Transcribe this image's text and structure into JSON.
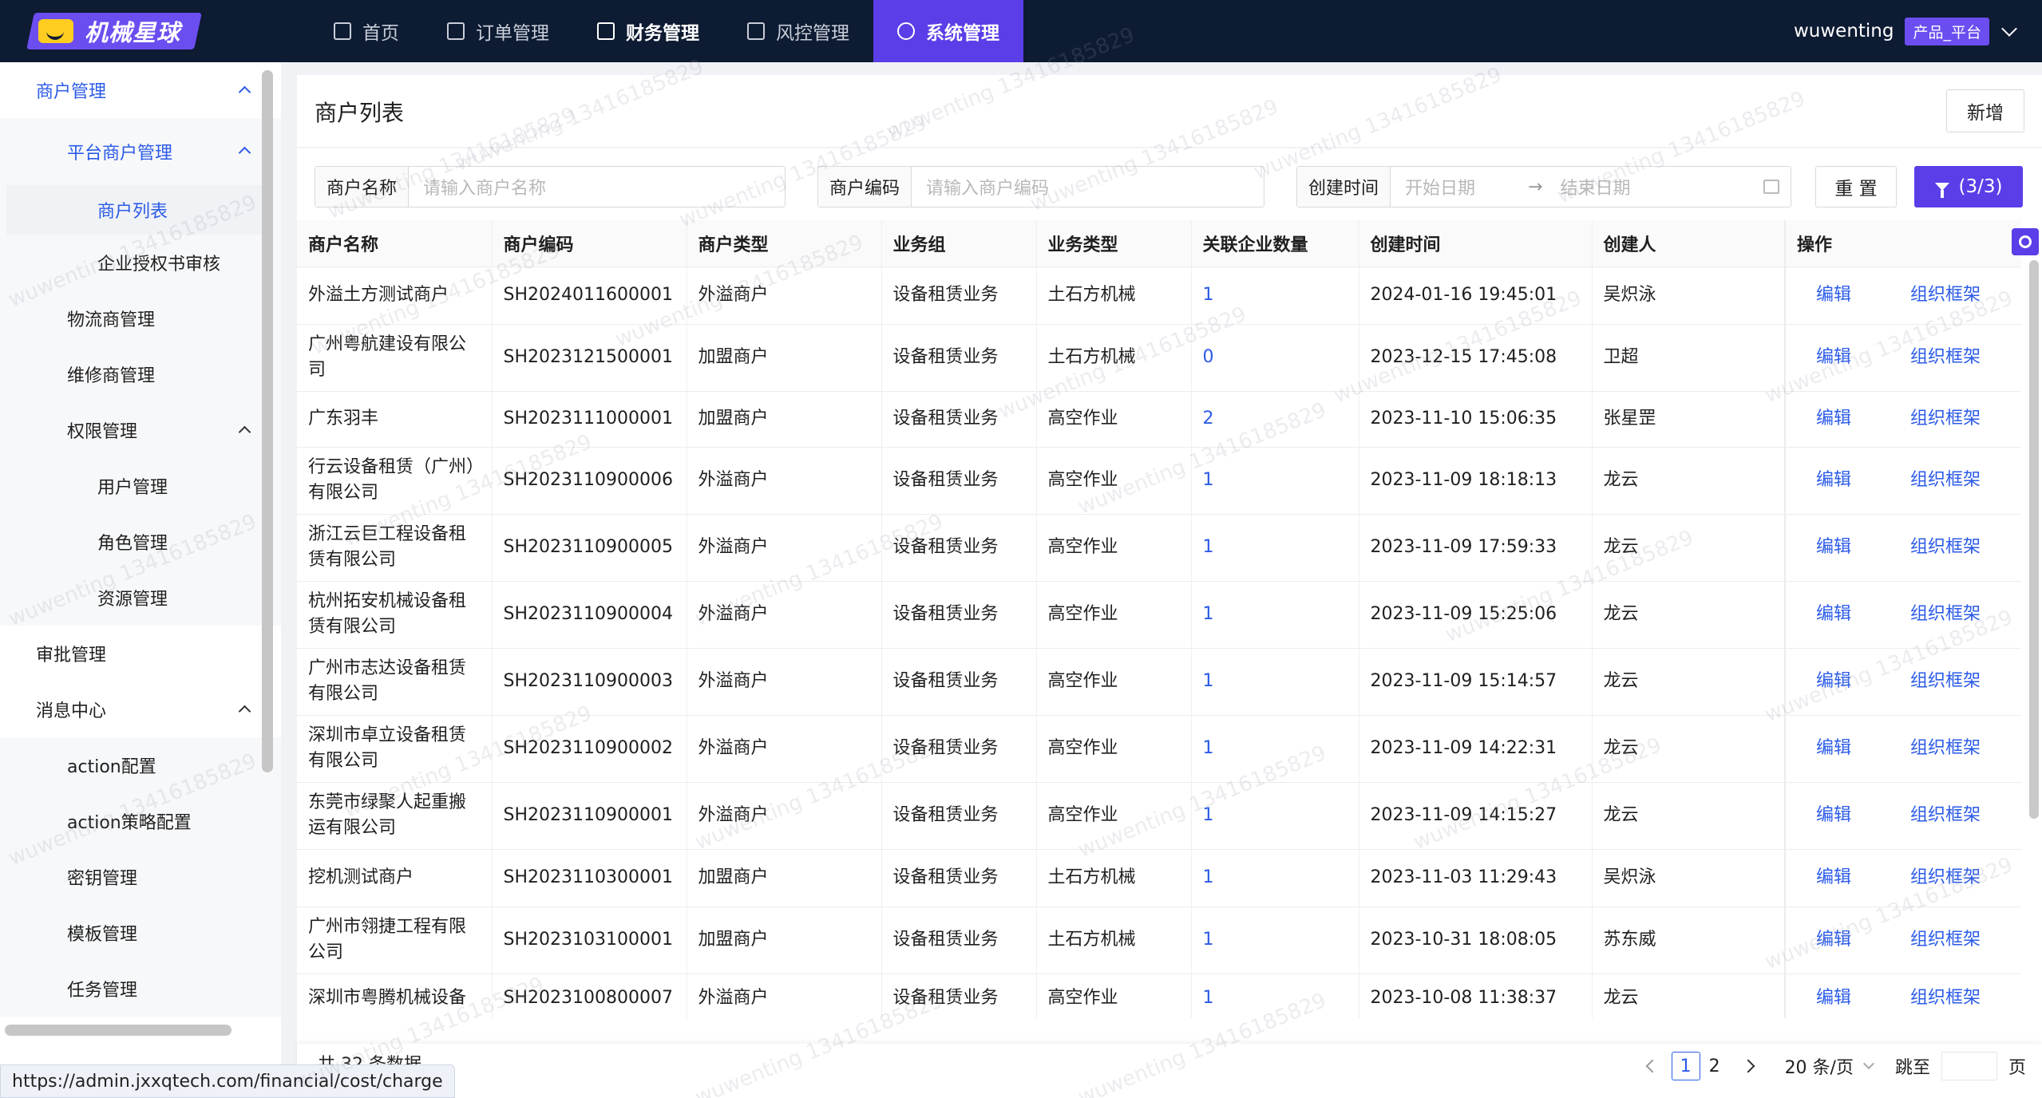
{
  "app": {
    "logo_text": "机械星球"
  },
  "nav": [
    {
      "label": "首页",
      "icon": "home-icon"
    },
    {
      "label": "订单管理",
      "icon": "order-icon"
    },
    {
      "label": "财务管理",
      "icon": "finance-icon"
    },
    {
      "label": "风控管理",
      "icon": "shield-icon"
    },
    {
      "label": "系统管理",
      "icon": "gear-icon"
    }
  ],
  "user": {
    "name": "wuwenting",
    "role": "产品_平台"
  },
  "sidebar": {
    "merchant": "商户管理",
    "platform_merchant": "平台商户管理",
    "merchant_list": "商户列表",
    "auth_review": "企业授权书审核",
    "logistics": "物流商管理",
    "repair": "维修商管理",
    "permission": "权限管理",
    "user_mgmt": "用户管理",
    "role_mgmt": "角色管理",
    "resource_mgmt": "资源管理",
    "approval": "审批管理",
    "message": "消息中心",
    "action_config": "action配置",
    "action_policy": "action策略配置",
    "key_mgmt": "密钥管理",
    "template_mgmt": "模板管理",
    "task_mgmt": "任务管理"
  },
  "page": {
    "title": "商户列表",
    "add_label": "新增"
  },
  "filters": {
    "name_label": "商户名称",
    "name_placeholder": "请输入商户名称",
    "code_label": "商户编码",
    "code_placeholder": "请输入商户编码",
    "time_label": "创建时间",
    "start_placeholder": "开始日期",
    "arrow": "→",
    "end_placeholder": "结束日期",
    "reset_label": "重 置",
    "filter_label": "(3/3)"
  },
  "table": {
    "headers": [
      "商户名称",
      "商户编码",
      "商户类型",
      "业务组",
      "业务类型",
      "关联企业数量",
      "创建时间",
      "创建人",
      "操作"
    ],
    "edit_label": "编辑",
    "org_label": "组织框架",
    "rows": [
      [
        "外溢土方测试商户",
        "SH2024011600001",
        "外溢商户",
        "设备租赁业务",
        "土石方机械",
        "1",
        "2024-01-16 19:45:01",
        "吴炽泳"
      ],
      [
        "广州粤航建设有限公司",
        "SH2023121500001",
        "加盟商户",
        "设备租赁业务",
        "土石方机械",
        "0",
        "2023-12-15 17:45:08",
        "卫超"
      ],
      [
        "广东羽丰",
        "SH2023111000001",
        "加盟商户",
        "设备租赁业务",
        "高空作业",
        "2",
        "2023-11-10 15:06:35",
        "张星罡"
      ],
      [
        "行云设备租赁（广州）有限公司",
        "SH2023110900006",
        "外溢商户",
        "设备租赁业务",
        "高空作业",
        "1",
        "2023-11-09 18:18:13",
        "龙云"
      ],
      [
        "浙江云巨工程设备租赁有限公司",
        "SH2023110900005",
        "外溢商户",
        "设备租赁业务",
        "高空作业",
        "1",
        "2023-11-09 17:59:33",
        "龙云"
      ],
      [
        "杭州拓安机械设备租赁有限公司",
        "SH2023110900004",
        "外溢商户",
        "设备租赁业务",
        "高空作业",
        "1",
        "2023-11-09 15:25:06",
        "龙云"
      ],
      [
        "广州市志达设备租赁有限公司",
        "SH2023110900003",
        "外溢商户",
        "设备租赁业务",
        "高空作业",
        "1",
        "2023-11-09 15:14:57",
        "龙云"
      ],
      [
        "深圳市卓立设备租赁有限公司",
        "SH2023110900002",
        "外溢商户",
        "设备租赁业务",
        "高空作业",
        "1",
        "2023-11-09 14:22:31",
        "龙云"
      ],
      [
        "东莞市绿聚人起重搬运有限公司",
        "SH2023110900001",
        "外溢商户",
        "设备租赁业务",
        "高空作业",
        "1",
        "2023-11-09 14:15:27",
        "龙云"
      ],
      [
        "挖机测试商户",
        "SH2023110300001",
        "加盟商户",
        "设备租赁业务",
        "土石方机械",
        "1",
        "2023-11-03 11:29:43",
        "吴炽泳"
      ],
      [
        "广州市翎捷工程有限公司",
        "SH2023103100001",
        "加盟商户",
        "设备租赁业务",
        "土石方机械",
        "1",
        "2023-10-31 18:08:05",
        "苏东威"
      ],
      [
        "深圳市粤腾机械设备",
        "SH2023100800007",
        "外溢商户",
        "设备租赁业务",
        "高空作业",
        "1",
        "2023-10-08 11:38:37",
        "龙云"
      ]
    ]
  },
  "footer": {
    "total": "共 32 条数据",
    "pages": [
      "1",
      "2"
    ],
    "page_size": "20 条/页",
    "jump_label": "跳至",
    "page_suffix": "页"
  },
  "status_url": "https://admin.jxxqtech.com/financial/cost/charge",
  "watermark": "wuwenting 13416185829",
  "colors": {
    "primary": "#5b3ee8",
    "link": "#2b5be8",
    "topbar": "#0d1b33",
    "logo_yellow": "#ffcd1f"
  }
}
